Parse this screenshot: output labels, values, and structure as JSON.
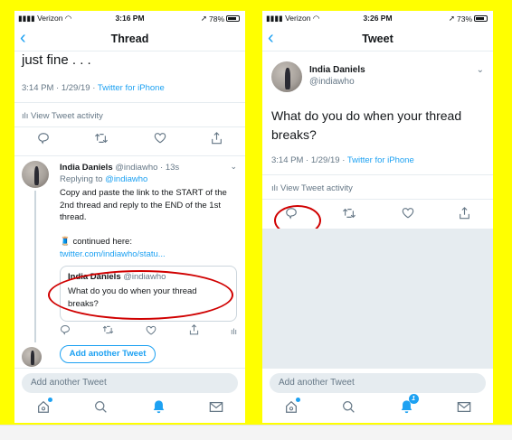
{
  "colors": {
    "accent": "#1da1f2",
    "highlight": "#ffff00",
    "annotation": "#d00000"
  },
  "left": {
    "status": {
      "carrier": "Verizon",
      "time": "3:16 PM",
      "battery": "78%"
    },
    "nav": {
      "title": "Thread"
    },
    "prev_tweet": {
      "tail_text": "just fine . . .",
      "time": "3:14 PM",
      "date": "1/29/19",
      "client": "Twitter for iPhone",
      "activity_label": "View Tweet activity"
    },
    "reply": {
      "name": "India Daniels",
      "handle": "@indiawho",
      "age": "13s",
      "replying_prefix": "Replying to",
      "replying_handle": "@indiawho",
      "body": "Copy and paste the link to the START of the 2nd thread and reply to the END of the 1st thread.",
      "emoji": "🧵",
      "continued_prefix": "continued here:",
      "link_text": "twitter.com/indiawho/statu...",
      "quote": {
        "name": "India Daniels",
        "handle": "@indiawho",
        "text": "What do you do when your thread breaks?"
      }
    },
    "add_tweet_button": "Add another Tweet",
    "compose_placeholder": "Add another Tweet"
  },
  "right": {
    "status": {
      "carrier": "Verizon",
      "time": "3:26 PM",
      "battery": "73%"
    },
    "nav": {
      "title": "Tweet"
    },
    "tweet": {
      "name": "India Daniels",
      "handle": "@indiawho",
      "text": "What do you do when your thread breaks?",
      "time": "3:14 PM",
      "date": "1/29/19",
      "client": "Twitter for iPhone",
      "activity_label": "View Tweet activity"
    },
    "compose_placeholder": "Add another Tweet",
    "notifications_badge": "1"
  }
}
